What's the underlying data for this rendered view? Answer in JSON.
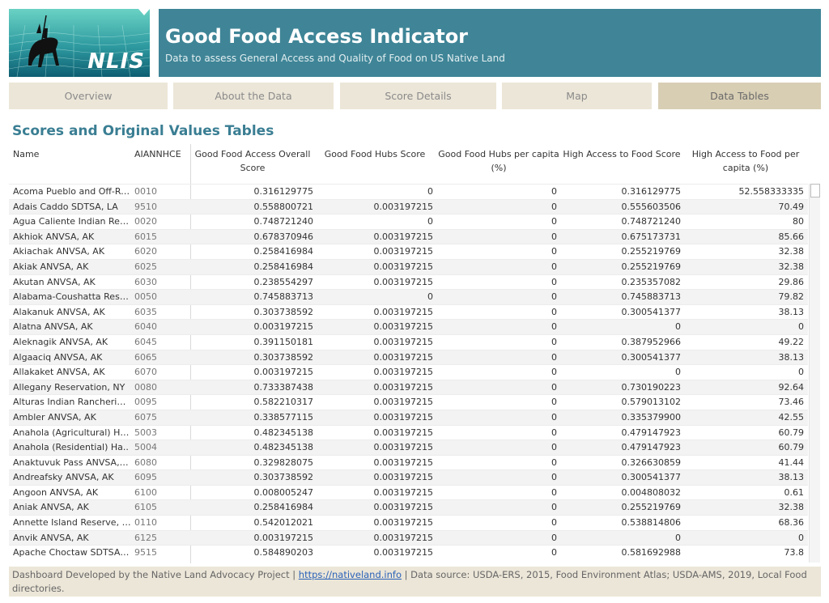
{
  "header": {
    "title": "Good Food Access Indicator",
    "subtitle": "Data to assess General Access and Quality of Food on US Native Land",
    "logo_text": "NLIS"
  },
  "nav": {
    "tabs": [
      {
        "label": "Overview"
      },
      {
        "label": "About the Data"
      },
      {
        "label": "Score Details"
      },
      {
        "label": "Map"
      },
      {
        "label": "Data Tables"
      }
    ],
    "active": "Data Tables"
  },
  "section_title": "Scores and Original Values Tables",
  "table": {
    "columns": {
      "name": "Name",
      "code": "AIANNHCE",
      "overall_1": "Good Food Access Overall",
      "overall_2": "Score",
      "hubs": "Good Food Hubs Score",
      "hubs_pc_1": "Good Food Hubs per capita",
      "hubs_pc_2": "(%)",
      "high": "High Access to Food Score",
      "high_pc_1": "High Access to Food per",
      "high_pc_2": "capita (%)"
    },
    "rows": [
      {
        "name": "Acoma Pueblo and Off-Re..",
        "code": "0010",
        "overall": "0.316129775",
        "hubs": "0",
        "hubs_pc": "0",
        "high": "0.316129775",
        "high_pc": "52.558333335"
      },
      {
        "name": "Adais Caddo SDTSA, LA",
        "code": "9510",
        "overall": "0.558800721",
        "hubs": "0.003197215",
        "hubs_pc": "0",
        "high": "0.555603506",
        "high_pc": "70.49"
      },
      {
        "name": "Agua Caliente Indian Rese..",
        "code": "0020",
        "overall": "0.748721240",
        "hubs": "0",
        "hubs_pc": "0",
        "high": "0.748721240",
        "high_pc": "80"
      },
      {
        "name": "Akhiok ANVSA, AK",
        "code": "6015",
        "overall": "0.678370946",
        "hubs": "0.003197215",
        "hubs_pc": "0",
        "high": "0.675173731",
        "high_pc": "85.66"
      },
      {
        "name": "Akiachak ANVSA, AK",
        "code": "6020",
        "overall": "0.258416984",
        "hubs": "0.003197215",
        "hubs_pc": "0",
        "high": "0.255219769",
        "high_pc": "32.38"
      },
      {
        "name": "Akiak ANVSA, AK",
        "code": "6025",
        "overall": "0.258416984",
        "hubs": "0.003197215",
        "hubs_pc": "0",
        "high": "0.255219769",
        "high_pc": "32.38"
      },
      {
        "name": "Akutan ANVSA, AK",
        "code": "6030",
        "overall": "0.238554297",
        "hubs": "0.003197215",
        "hubs_pc": "0",
        "high": "0.235357082",
        "high_pc": "29.86"
      },
      {
        "name": "Alabama-Coushatta Reser..",
        "code": "0050",
        "overall": "0.745883713",
        "hubs": "0",
        "hubs_pc": "0",
        "high": "0.745883713",
        "high_pc": "79.82"
      },
      {
        "name": "Alakanuk ANVSA, AK",
        "code": "6035",
        "overall": "0.303738592",
        "hubs": "0.003197215",
        "hubs_pc": "0",
        "high": "0.300541377",
        "high_pc": "38.13"
      },
      {
        "name": "Alatna ANVSA, AK",
        "code": "6040",
        "overall": "0.003197215",
        "hubs": "0.003197215",
        "hubs_pc": "0",
        "high": "0",
        "high_pc": "0"
      },
      {
        "name": "Aleknagik ANVSA, AK",
        "code": "6045",
        "overall": "0.391150181",
        "hubs": "0.003197215",
        "hubs_pc": "0",
        "high": "0.387952966",
        "high_pc": "49.22"
      },
      {
        "name": "Algaaciq ANVSA, AK",
        "code": "6065",
        "overall": "0.303738592",
        "hubs": "0.003197215",
        "hubs_pc": "0",
        "high": "0.300541377",
        "high_pc": "38.13"
      },
      {
        "name": "Allakaket ANVSA, AK",
        "code": "6070",
        "overall": "0.003197215",
        "hubs": "0.003197215",
        "hubs_pc": "0",
        "high": "0",
        "high_pc": "0"
      },
      {
        "name": "Allegany Reservation, NY",
        "code": "0080",
        "overall": "0.733387438",
        "hubs": "0.003197215",
        "hubs_pc": "0",
        "high": "0.730190223",
        "high_pc": "92.64"
      },
      {
        "name": "Alturas Indian Rancheria, ..",
        "code": "0095",
        "overall": "0.582210317",
        "hubs": "0.003197215",
        "hubs_pc": "0",
        "high": "0.579013102",
        "high_pc": "73.46"
      },
      {
        "name": "Ambler ANVSA, AK",
        "code": "6075",
        "overall": "0.338577115",
        "hubs": "0.003197215",
        "hubs_pc": "0",
        "high": "0.335379900",
        "high_pc": "42.55"
      },
      {
        "name": "Anahola (Agricultural) Ha..",
        "code": "5003",
        "overall": "0.482345138",
        "hubs": "0.003197215",
        "hubs_pc": "0",
        "high": "0.479147923",
        "high_pc": "60.79"
      },
      {
        "name": "Anahola (Residential) Ha..",
        "code": "5004",
        "overall": "0.482345138",
        "hubs": "0.003197215",
        "hubs_pc": "0",
        "high": "0.479147923",
        "high_pc": "60.79"
      },
      {
        "name": "Anaktuvuk Pass ANVSA, AK",
        "code": "6080",
        "overall": "0.329828075",
        "hubs": "0.003197215",
        "hubs_pc": "0",
        "high": "0.326630859",
        "high_pc": "41.44"
      },
      {
        "name": "Andreafsky ANVSA, AK",
        "code": "6095",
        "overall": "0.303738592",
        "hubs": "0.003197215",
        "hubs_pc": "0",
        "high": "0.300541377",
        "high_pc": "38.13"
      },
      {
        "name": "Angoon ANVSA, AK",
        "code": "6100",
        "overall": "0.008005247",
        "hubs": "0.003197215",
        "hubs_pc": "0",
        "high": "0.004808032",
        "high_pc": "0.61"
      },
      {
        "name": "Aniak ANVSA, AK",
        "code": "6105",
        "overall": "0.258416984",
        "hubs": "0.003197215",
        "hubs_pc": "0",
        "high": "0.255219769",
        "high_pc": "32.38"
      },
      {
        "name": "Annette Island Reserve, AK",
        "code": "0110",
        "overall": "0.542012021",
        "hubs": "0.003197215",
        "hubs_pc": "0",
        "high": "0.538814806",
        "high_pc": "68.36"
      },
      {
        "name": "Anvik ANVSA, AK",
        "code": "6125",
        "overall": "0.003197215",
        "hubs": "0.003197215",
        "hubs_pc": "0",
        "high": "0",
        "high_pc": "0"
      },
      {
        "name": "Apache Choctaw SDTSA, LA",
        "code": "9515",
        "overall": "0.584890203",
        "hubs": "0.003197215",
        "hubs_pc": "0",
        "high": "0.581692988",
        "high_pc": "73.8"
      }
    ]
  },
  "footer": {
    "prefix": "Dashboard Developed by the Native Land Advocacy Project | ",
    "link": "https://nativeland.info",
    "suffix": " | Data source: USDA-ERS, 2015, Food Environment Atlas; USDA-AMS, 2019, Local Food directories."
  }
}
